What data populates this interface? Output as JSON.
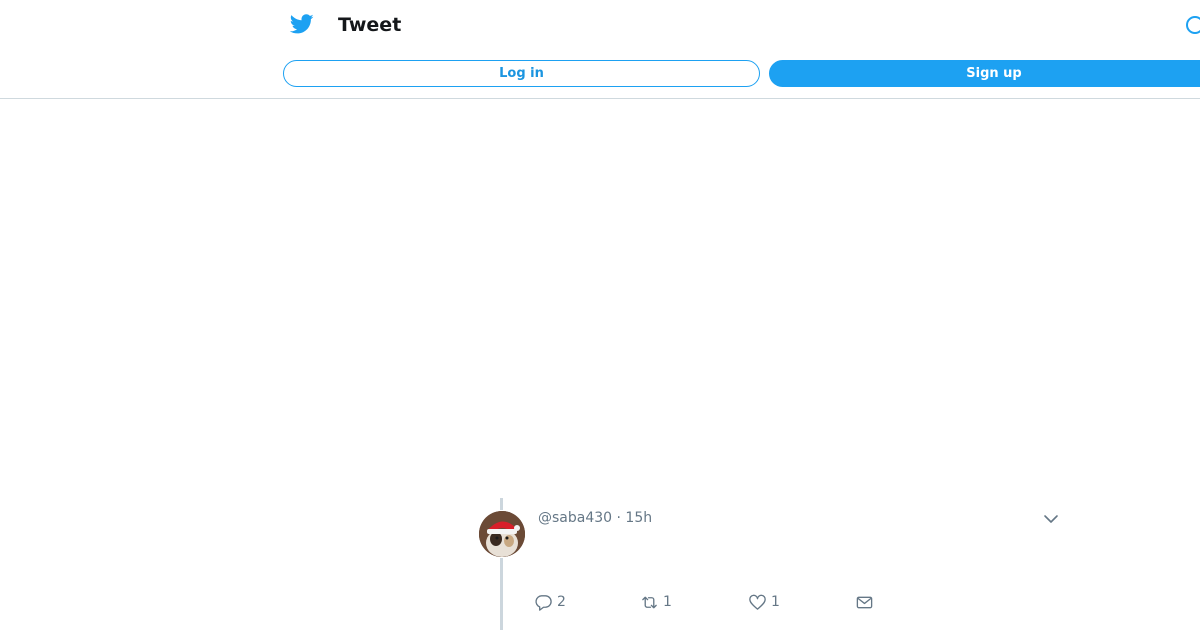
{
  "header": {
    "title": "Tweet",
    "login_label": "Log in",
    "signup_label": "Sign up",
    "logo_icon": "twitter-bird-icon",
    "search_icon": "search-icon"
  },
  "colors": {
    "accent": "#1da1f2",
    "muted_text": "#657786",
    "thread_line": "#ccd6dd",
    "divider": "#cfd9de"
  },
  "tweet": {
    "handle": "@saba430",
    "separator": "·",
    "time": "15h",
    "avatar_icon": "avatar-cat-santa-hat",
    "actions": {
      "reply_count": "2",
      "retweet_count": "1",
      "like_count": "1"
    }
  }
}
